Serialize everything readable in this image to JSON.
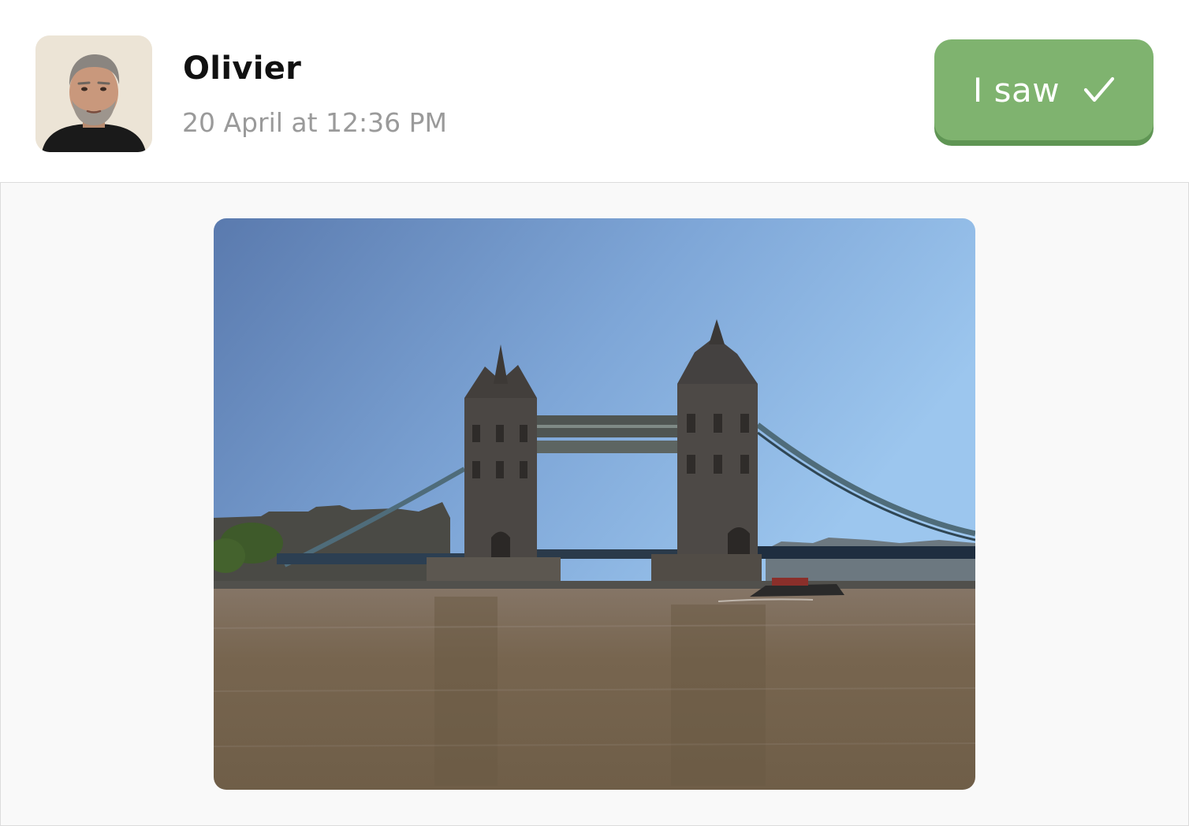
{
  "post": {
    "author": {
      "name": "Olivier",
      "avatar_icon": "person-portrait-icon"
    },
    "date": "20 April at 12:36 PM",
    "seen_button": {
      "label": "I saw",
      "icon": "checkmark-icon",
      "color": "#7fb36f"
    },
    "photo": {
      "subject": "tower-bridge-photo"
    }
  },
  "colors": {
    "name": "#111111",
    "date": "#9a9a9a",
    "button": "#7fb36f",
    "button_shadow": "#5f9554",
    "content_background": "#f9f9f9"
  }
}
